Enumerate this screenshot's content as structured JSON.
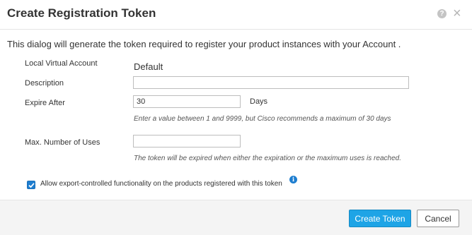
{
  "dialog": {
    "title": "Create Registration Token",
    "intro": "This dialog will generate the token required to register your product instances with your Account ."
  },
  "form": {
    "virtual_account": {
      "label": "Local Virtual Account",
      "value": "Default"
    },
    "description": {
      "label": "Description",
      "value": ""
    },
    "expire_after": {
      "label": "Expire After",
      "value": "30",
      "unit": "Days",
      "hint": "Enter a value between 1 and 9999, but Cisco recommends a maximum of 30 days"
    },
    "max_uses": {
      "label": "Max. Number of Uses",
      "value": "",
      "hint": "The token will be expired when either the expiration or the maximum uses is reached."
    },
    "export_controlled": {
      "label": "Allow export-controlled functionality on the products registered with this token",
      "checked": true
    }
  },
  "icons": {
    "help": "help-circle-icon",
    "close": "close-icon",
    "info": "info-circle-icon",
    "check": "checkmark-icon"
  },
  "colors": {
    "primary_button": "#1ea4e6",
    "checkbox": "#1e7ed0",
    "info_icon": "#1e7ed0"
  },
  "buttons": {
    "create": "Create Token",
    "cancel": "Cancel"
  }
}
